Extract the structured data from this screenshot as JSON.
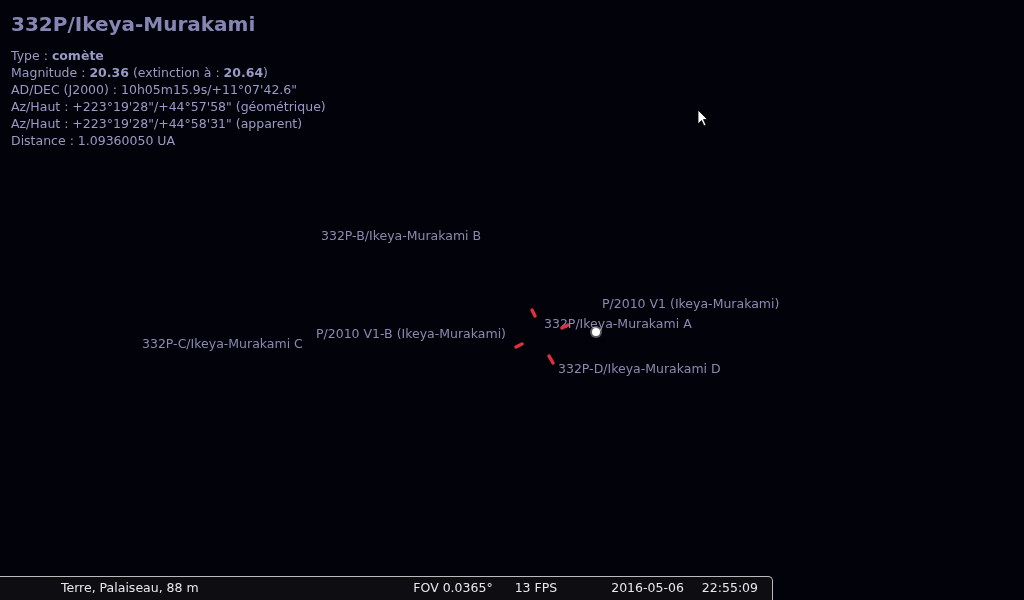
{
  "object_info": {
    "title": "332P/Ikeya-Murakami",
    "lines": [
      "Type : **comète**",
      "Magnitude : **20.36** (extinction à : **20.64**)",
      "AD/DEC (J2000) : 10h05m15.9s/+11°07'42.6\"",
      "Az/Haut : +223°19'28\"/+44°57'58\" (géométrique)",
      "Az/Haut : +223°19'28\"/+44°58'31\" (apparent)",
      "Distance : 1.09360050 UA"
    ]
  },
  "sky_labels": [
    {
      "text": "332P-B/Ikeya-Murakami B"
    },
    {
      "text": "332P-C/Ikeya-Murakami C"
    },
    {
      "text": "P/2010 V1-B (Ikeya-Murakami)"
    },
    {
      "text": "332P/Ikeya-Murakami A"
    },
    {
      "text": "P/2010 V1 (Ikeya-Murakami)"
    },
    {
      "text": "332P-D/Ikeya-Murakami D"
    }
  ],
  "status_bar": {
    "location": "Terre, Palaiseau, 88 m",
    "fov": "FOV 0.0365°",
    "fps": "13 FPS",
    "date": "2016-05-06",
    "time": "22:55:09"
  }
}
